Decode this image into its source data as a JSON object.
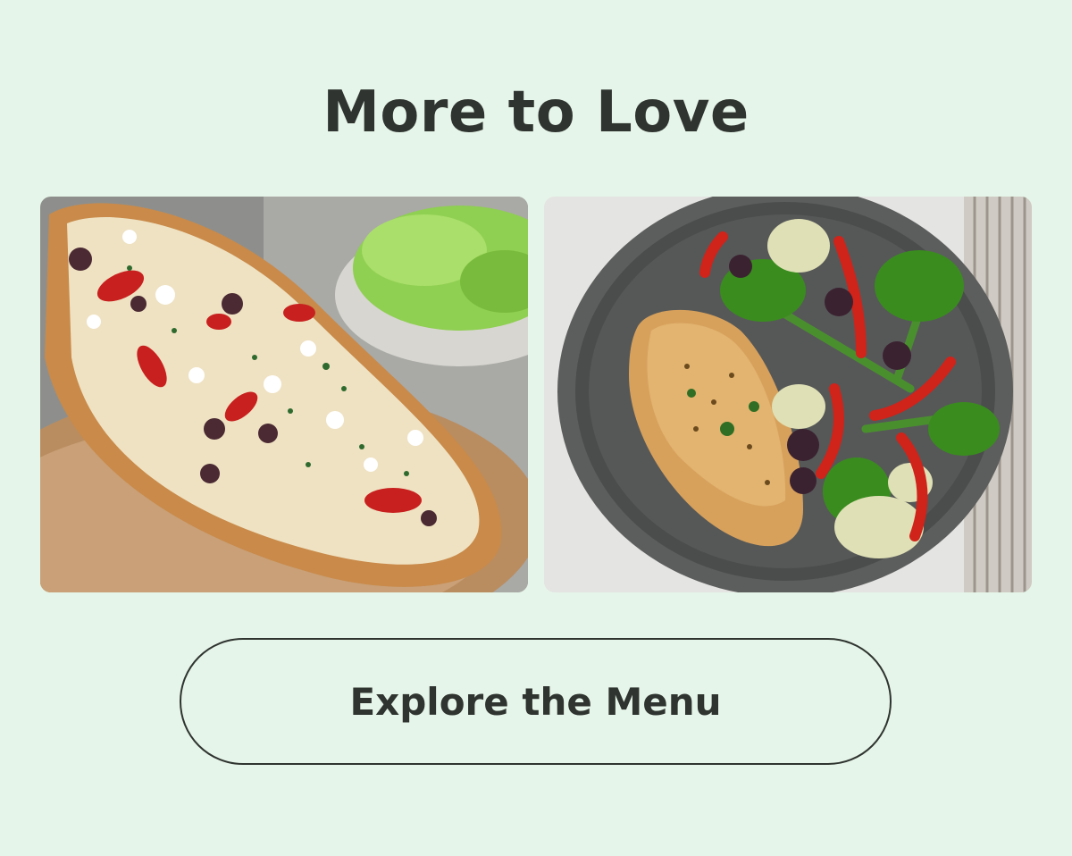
{
  "section": {
    "title": "More to Love"
  },
  "photos": [
    {
      "subject": "flatbread with feta, artichokes, roasted red peppers and olives"
    },
    {
      "subject": "seared chicken breast with broccolini, artichokes, peppers and olives"
    }
  ],
  "cta": {
    "label": "Explore the Menu"
  },
  "colors": {
    "background": "#e6f5e9",
    "text": "#2f3430",
    "button_border": "#2f3430"
  }
}
